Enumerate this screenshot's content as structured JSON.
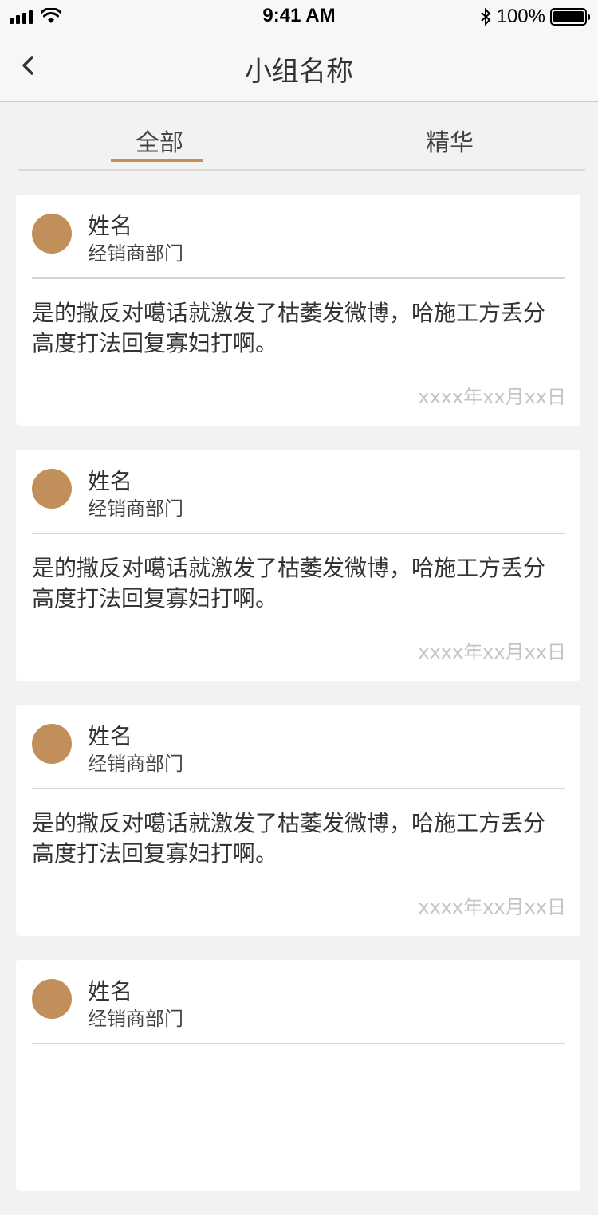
{
  "status_bar": {
    "time": "9:41 AM",
    "battery": "100%",
    "battery_level": 1.0
  },
  "nav": {
    "title": "小组名称"
  },
  "tabs": [
    {
      "label": "全部",
      "active": true
    },
    {
      "label": "精华",
      "active": false
    }
  ],
  "colors": {
    "accent": "#c1905a",
    "date_text": "#c4c4c4"
  },
  "posts": [
    {
      "name": "姓名",
      "department": "经销商部门",
      "content": "是的撒反对噶话就激发了枯萎发微博，哈施工方丢分高度打法回复寡妇打啊。",
      "date": "xxxx年xx月xx日"
    },
    {
      "name": "姓名",
      "department": "经销商部门",
      "content": "是的撒反对噶话就激发了枯萎发微博，哈施工方丢分高度打法回复寡妇打啊。",
      "date": "xxxx年xx月xx日"
    },
    {
      "name": "姓名",
      "department": "经销商部门",
      "content": "是的撒反对噶话就激发了枯萎发微博，哈施工方丢分高度打法回复寡妇打啊。",
      "date": "xxxx年xx月xx日"
    },
    {
      "name": "姓名",
      "department": "经销商部门"
    }
  ]
}
